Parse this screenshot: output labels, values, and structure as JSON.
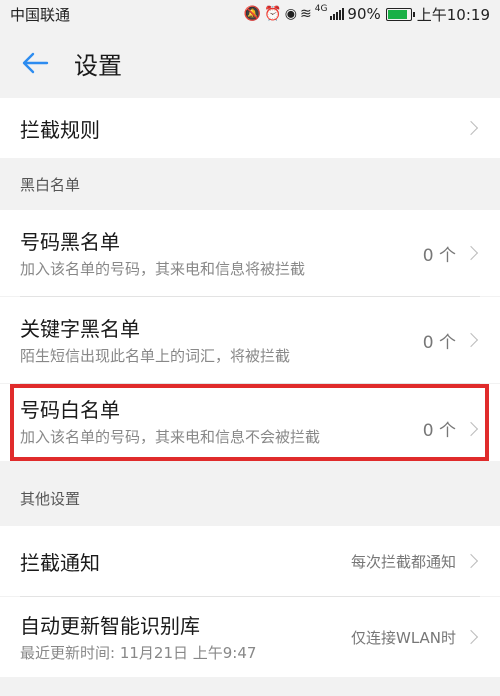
{
  "status_bar": {
    "carrier": "中国联通",
    "network": "4G",
    "battery": "90%",
    "battery_level": 0.9,
    "time": "上午10:19"
  },
  "app_bar": {
    "title": "设置"
  },
  "rows": {
    "block_rules": {
      "title": "拦截规则"
    },
    "number_blacklist": {
      "title": "号码黑名单",
      "subtitle": "加入该名单的号码，其来电和信息将被拦截",
      "value": "0 个"
    },
    "keyword_blacklist": {
      "title": "关键字黑名单",
      "subtitle": "陌生短信出现此名单上的词汇，将被拦截",
      "value": "0 个"
    },
    "number_whitelist": {
      "title": "号码白名单",
      "subtitle": "加入该名单的号码，其来电和信息不会被拦截",
      "value": "0 个"
    },
    "block_notification": {
      "title": "拦截通知",
      "value": "每次拦截都通知"
    },
    "auto_update": {
      "title": "自动更新智能识别库",
      "subtitle": "最近更新时间: 11月21日 上午9:47",
      "value": "仅连接WLAN时"
    }
  },
  "sections": {
    "blackwhite": "黑白名单",
    "other": "其他设置"
  },
  "colors": {
    "accent": "#2d8cf0",
    "highlight": "#e02b2b"
  }
}
